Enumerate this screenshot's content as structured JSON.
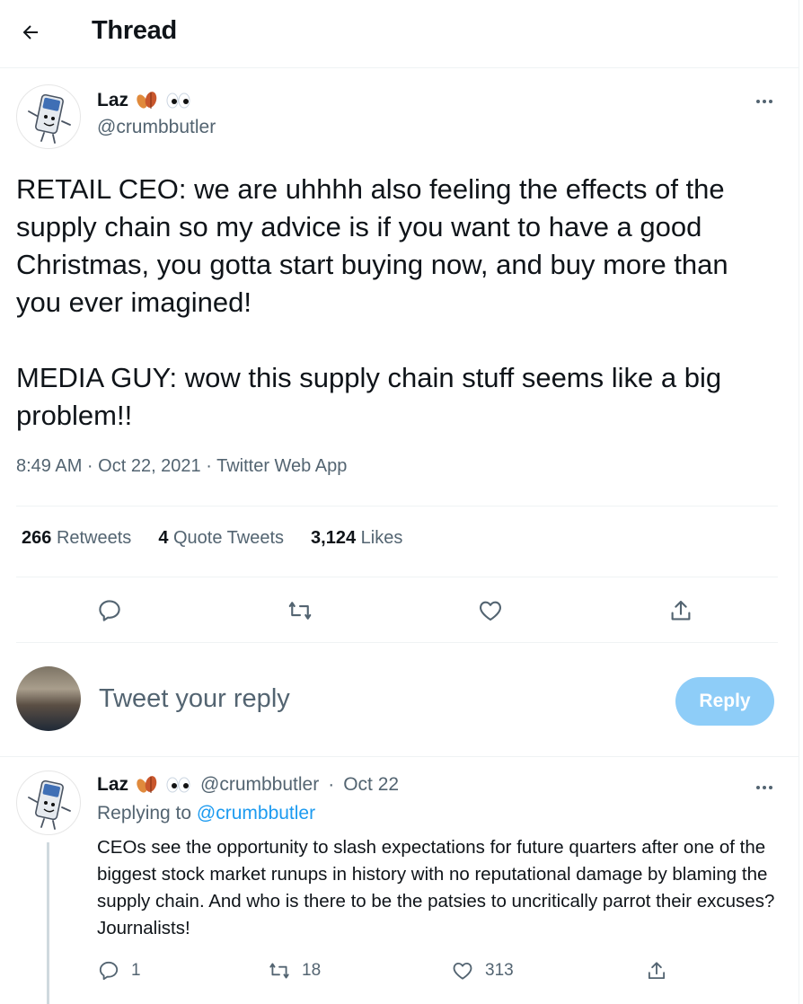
{
  "header": {
    "title": "Thread"
  },
  "tweet": {
    "name": "Laz",
    "handle": "@crumbbutler",
    "text": "RETAIL CEO: we are uhhhh also feeling the effects of the supply chain so my advice is if you want to have a good Christmas, you gotta start buying now, and buy more than you ever imagined!\n\nMEDIA GUY: wow this supply chain stuff seems like a big problem!!",
    "timestamp": "8:49 AM · Oct 22, 2021 · Twitter Web App",
    "stats": {
      "retweets_count": "266",
      "retweets_label": "Retweets",
      "quotes_count": "4",
      "quotes_label": "Quote Tweets",
      "likes_count": "3,124",
      "likes_label": "Likes"
    }
  },
  "composer": {
    "placeholder": "Tweet your reply",
    "button_label": "Reply"
  },
  "reply": {
    "name": "Laz",
    "handle": "@crumbbutler",
    "separator": "·",
    "date": "Oct 22",
    "replying_prefix": "Replying to",
    "replying_to": "@crumbbutler",
    "text": "CEOs see the opportunity to slash expectations for future quarters after one of the biggest stock market runups in history with no reputational damage by blaming the supply chain. And who is there to be the patsies to uncritically parrot their excuses? Journalists!",
    "reply_count": "1",
    "retweet_count": "18",
    "like_count": "313"
  },
  "colors": {
    "accent": "#1d9bf0",
    "reply_button": "#8ecdf8",
    "secondary_text": "#536471"
  },
  "icons": [
    "back-arrow-icon",
    "leaf-emoji-icon",
    "eyes-emoji-icon",
    "more-icon",
    "reply-icon",
    "retweet-icon",
    "like-icon",
    "share-icon"
  ]
}
